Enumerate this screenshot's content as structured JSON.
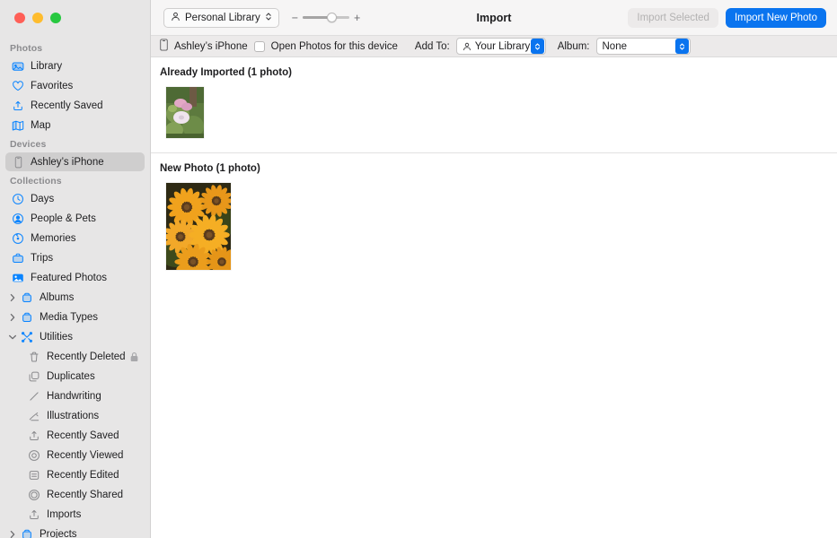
{
  "window": {
    "title": "Import",
    "traffic_lights": [
      "close",
      "minimize",
      "zoom"
    ]
  },
  "toolbar": {
    "library_popup": {
      "label": "Personal Library",
      "icon": "person-icon",
      "chevron": "chevron-updown-icon"
    },
    "zoom": {
      "minus": "−",
      "plus": "+",
      "value_percent": 58
    },
    "import_selected_label": "Import Selected",
    "import_selected_enabled": false,
    "import_new_label": "Import New Photo",
    "import_new_enabled": true,
    "accent_blue": "#0a74ef",
    "disabled_text": "#b3b2b2"
  },
  "device_bar": {
    "device_icon": "iphone-icon",
    "device_name": "Ashley’s iPhone",
    "open_photos_label": "Open Photos for this device",
    "open_photos_checked": false,
    "add_to_label": "Add To:",
    "add_to_value": "Your Library",
    "album_label": "Album:",
    "album_value": "None"
  },
  "sidebar": {
    "sections": [
      {
        "title": "Photos",
        "items": [
          {
            "label": "Library",
            "icon": "library-icon",
            "color": "blue",
            "selected": false,
            "indent": 0,
            "chevron": null
          },
          {
            "label": "Favorites",
            "icon": "heart-icon",
            "color": "blue",
            "selected": false,
            "indent": 0,
            "chevron": null
          },
          {
            "label": "Recently Saved",
            "icon": "tray-arrow-up-icon",
            "color": "blue",
            "selected": false,
            "indent": 0,
            "chevron": null
          },
          {
            "label": "Map",
            "icon": "map-icon",
            "color": "blue",
            "selected": false,
            "indent": 0,
            "chevron": null
          }
        ]
      },
      {
        "title": "Devices",
        "items": [
          {
            "label": "Ashley’s iPhone",
            "icon": "iphone-icon",
            "color": "grey",
            "selected": true,
            "indent": 0,
            "chevron": null
          }
        ]
      },
      {
        "title": "Collections",
        "items": [
          {
            "label": "Days",
            "icon": "clock-icon",
            "color": "blue",
            "selected": false,
            "indent": 0,
            "chevron": null
          },
          {
            "label": "People & Pets",
            "icon": "person-circle-icon",
            "color": "blue",
            "selected": false,
            "indent": 0,
            "chevron": null
          },
          {
            "label": "Memories",
            "icon": "memories-icon",
            "color": "blue",
            "selected": false,
            "indent": 0,
            "chevron": null
          },
          {
            "label": "Trips",
            "icon": "suitcase-icon",
            "color": "blue",
            "selected": false,
            "indent": 0,
            "chevron": null
          },
          {
            "label": "Featured Photos",
            "icon": "photo-icon",
            "color": "blue",
            "selected": false,
            "indent": 0,
            "chevron": null
          },
          {
            "label": "Albums",
            "icon": "album-icon",
            "color": "blue",
            "selected": false,
            "indent": 0,
            "chevron": "collapsed"
          },
          {
            "label": "Media Types",
            "icon": "album-icon",
            "color": "blue",
            "selected": false,
            "indent": 0,
            "chevron": "collapsed"
          },
          {
            "label": "Utilities",
            "icon": "tools-icon",
            "color": "blue",
            "selected": false,
            "indent": 0,
            "chevron": "expanded"
          },
          {
            "label": "Recently Deleted",
            "icon": "trash-icon",
            "color": "grey",
            "selected": false,
            "indent": 1,
            "chevron": null,
            "badge": "lock-icon"
          },
          {
            "label": "Duplicates",
            "icon": "duplicates-icon",
            "color": "grey",
            "selected": false,
            "indent": 1,
            "chevron": null
          },
          {
            "label": "Handwriting",
            "icon": "pencil-line-icon",
            "color": "grey",
            "selected": false,
            "indent": 1,
            "chevron": null
          },
          {
            "label": "Illustrations",
            "icon": "illustration-icon",
            "color": "grey",
            "selected": false,
            "indent": 1,
            "chevron": null
          },
          {
            "label": "Recently Saved",
            "icon": "tray-arrow-up-icon",
            "color": "grey",
            "selected": false,
            "indent": 1,
            "chevron": null
          },
          {
            "label": "Recently Viewed",
            "icon": "target-icon",
            "color": "grey",
            "selected": false,
            "indent": 1,
            "chevron": null
          },
          {
            "label": "Recently Edited",
            "icon": "doc-lines-icon",
            "color": "grey",
            "selected": false,
            "indent": 1,
            "chevron": null
          },
          {
            "label": "Recently Shared",
            "icon": "circles-icon",
            "color": "grey",
            "selected": false,
            "indent": 1,
            "chevron": null
          },
          {
            "label": "Imports",
            "icon": "tray-arrow-up-icon",
            "color": "grey",
            "selected": false,
            "indent": 1,
            "chevron": null
          },
          {
            "label": "Projects",
            "icon": "album-icon",
            "color": "blue",
            "selected": false,
            "indent": 0,
            "chevron": "collapsed"
          }
        ]
      }
    ]
  },
  "content": {
    "sections": [
      {
        "heading": "Already Imported (1 photo)",
        "photos": [
          {
            "alt": "pink and white flowers with green foliage",
            "size": "small"
          }
        ]
      },
      {
        "heading": "New Photo (1 photo)",
        "photos": [
          {
            "alt": "cluster of orange black-eyed Susan flowers",
            "size": "large"
          }
        ]
      }
    ]
  }
}
